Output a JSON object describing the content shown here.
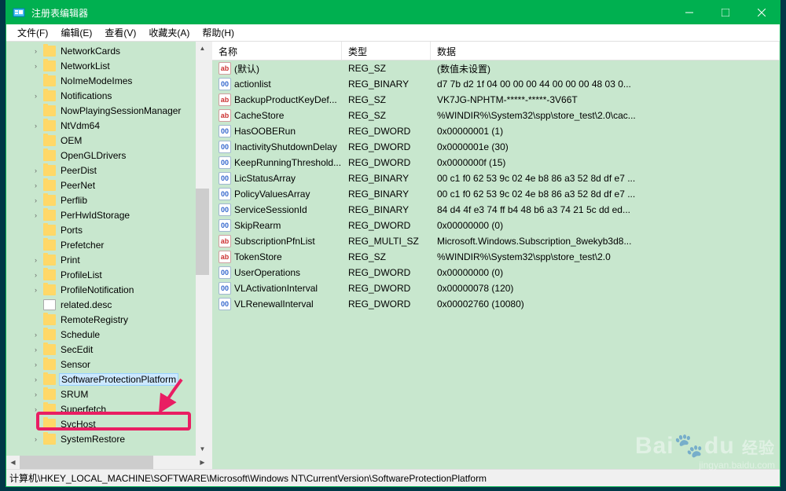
{
  "window": {
    "title": "注册表编辑器",
    "controls": {
      "min": "—",
      "max": "□",
      "close": "✕"
    }
  },
  "menu": {
    "file": "文件(F)",
    "edit": "编辑(E)",
    "view": "查看(V)",
    "favorites": "收藏夹(A)",
    "help": "帮助(H)"
  },
  "tree": {
    "items": [
      {
        "label": "NetworkCards",
        "exp": true
      },
      {
        "label": "NetworkList",
        "exp": true
      },
      {
        "label": "NoImeModeImes",
        "exp": false
      },
      {
        "label": "Notifications",
        "exp": true
      },
      {
        "label": "NowPlayingSessionManager",
        "exp": false
      },
      {
        "label": "NtVdm64",
        "exp": true
      },
      {
        "label": "OEM",
        "exp": false
      },
      {
        "label": "OpenGLDrivers",
        "exp": false
      },
      {
        "label": "PeerDist",
        "exp": true
      },
      {
        "label": "PeerNet",
        "exp": true
      },
      {
        "label": "Perflib",
        "exp": true
      },
      {
        "label": "PerHwIdStorage",
        "exp": true
      },
      {
        "label": "Ports",
        "exp": false
      },
      {
        "label": "Prefetcher",
        "exp": false
      },
      {
        "label": "Print",
        "exp": true
      },
      {
        "label": "ProfileList",
        "exp": true
      },
      {
        "label": "ProfileNotification",
        "exp": true
      },
      {
        "label": "related.desc",
        "exp": false,
        "icon": "desc"
      },
      {
        "label": "RemoteRegistry",
        "exp": false
      },
      {
        "label": "Schedule",
        "exp": true
      },
      {
        "label": "SecEdit",
        "exp": true
      },
      {
        "label": "Sensor",
        "exp": true
      },
      {
        "label": "SoftwareProtectionPlatform",
        "exp": true,
        "selected": true
      },
      {
        "label": "SRUM",
        "exp": true
      },
      {
        "label": "Superfetch",
        "exp": true
      },
      {
        "label": "SvcHost",
        "exp": false
      },
      {
        "label": "SystemRestore",
        "exp": true
      }
    ]
  },
  "list": {
    "headers": {
      "name": "名称",
      "type": "类型",
      "data": "数据"
    },
    "columns": {
      "name": 165,
      "type": 113,
      "data": 400
    },
    "rows": [
      {
        "icon": "sz",
        "name": "(默认)",
        "type": "REG_SZ",
        "data": "(数值未设置)"
      },
      {
        "icon": "bin",
        "name": "actionlist",
        "type": "REG_BINARY",
        "data": "d7 7b d2 1f 04 00 00 00 44 00 00 00 48 03 0..."
      },
      {
        "icon": "sz",
        "name": "BackupProductKeyDef...",
        "type": "REG_SZ",
        "data": "VK7JG-NPHTM-*****-*****-3V66T"
      },
      {
        "icon": "sz",
        "name": "CacheStore",
        "type": "REG_SZ",
        "data": "%WINDIR%\\System32\\spp\\store_test\\2.0\\cac..."
      },
      {
        "icon": "bin",
        "name": "HasOOBERun",
        "type": "REG_DWORD",
        "data": "0x00000001 (1)"
      },
      {
        "icon": "bin",
        "name": "InactivityShutdownDelay",
        "type": "REG_DWORD",
        "data": "0x0000001e (30)"
      },
      {
        "icon": "bin",
        "name": "KeepRunningThreshold...",
        "type": "REG_DWORD",
        "data": "0x0000000f (15)"
      },
      {
        "icon": "bin",
        "name": "LicStatusArray",
        "type": "REG_BINARY",
        "data": "00 c1 f0 62 53 9c 02 4e b8 86 a3 52 8d df e7 ..."
      },
      {
        "icon": "bin",
        "name": "PolicyValuesArray",
        "type": "REG_BINARY",
        "data": "00 c1 f0 62 53 9c 02 4e b8 86 a3 52 8d df e7 ..."
      },
      {
        "icon": "bin",
        "name": "ServiceSessionId",
        "type": "REG_BINARY",
        "data": "84 d4 4f e3 74 ff b4 48 b6 a3 74 21 5c dd ed..."
      },
      {
        "icon": "bin",
        "name": "SkipRearm",
        "type": "REG_DWORD",
        "data": "0x00000000 (0)"
      },
      {
        "icon": "sz",
        "name": "SubscriptionPfnList",
        "type": "REG_MULTI_SZ",
        "data": "Microsoft.Windows.Subscription_8wekyb3d8..."
      },
      {
        "icon": "sz",
        "name": "TokenStore",
        "type": "REG_SZ",
        "data": "%WINDIR%\\System32\\spp\\store_test\\2.0"
      },
      {
        "icon": "bin",
        "name": "UserOperations",
        "type": "REG_DWORD",
        "data": "0x00000000 (0)"
      },
      {
        "icon": "bin",
        "name": "VLActivationInterval",
        "type": "REG_DWORD",
        "data": "0x00000078 (120)"
      },
      {
        "icon": "bin",
        "name": "VLRenewalInterval",
        "type": "REG_DWORD",
        "data": "0x00002760 (10080)"
      }
    ]
  },
  "statusbar": {
    "path": "计算机\\HKEY_LOCAL_MACHINE\\SOFTWARE\\Microsoft\\Windows NT\\CurrentVersion\\SoftwareProtectionPlatform"
  },
  "watermark": {
    "logo1": "Bai",
    "logo2": "du",
    "logo3": "经验",
    "sub": "jingyan.baidu.com"
  }
}
